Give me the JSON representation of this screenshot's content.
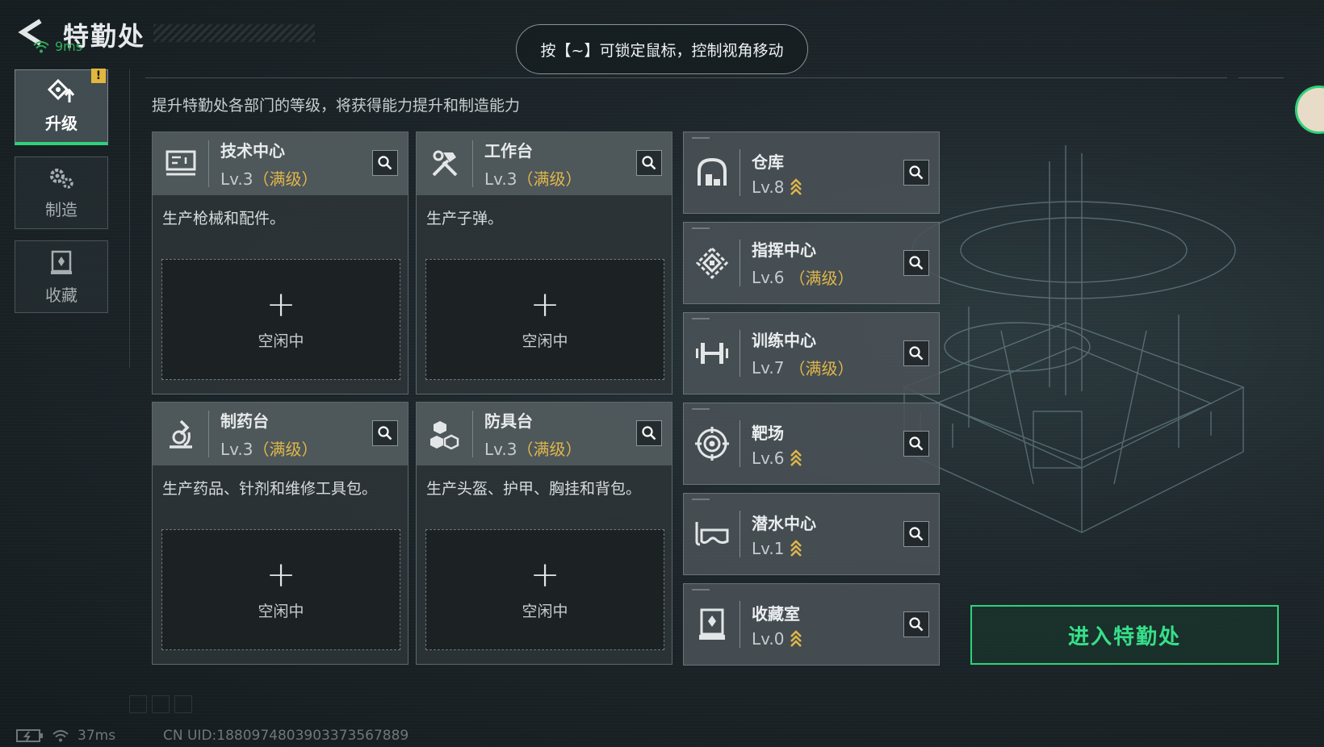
{
  "header": {
    "title": "特勤处",
    "ping_top": "9ms",
    "hint": "按【~】可锁定鼠标，控制视角移动"
  },
  "sidebar": {
    "items": [
      {
        "label": "升级",
        "icon": "upgrade-icon",
        "active": true,
        "alert": "!"
      },
      {
        "label": "制造",
        "icon": "gears-icon",
        "active": false
      },
      {
        "label": "收藏",
        "icon": "collection-icon",
        "active": false
      }
    ]
  },
  "subtitle": "提升特勤处各部门的等级，将获得能力提升和制造能力",
  "workstations": [
    {
      "name": "技术中心",
      "level": "Lv.3",
      "max": "（满级）",
      "desc": "生产枪械和配件。",
      "slot": "空闲中",
      "icon": "tech-center-icon"
    },
    {
      "name": "工作台",
      "level": "Lv.3",
      "max": "（满级）",
      "desc": "生产子弹。",
      "slot": "空闲中",
      "icon": "hammer-wrench-icon"
    },
    {
      "name": "制药台",
      "level": "Lv.3",
      "max": "（满级）",
      "desc": "生产药品、针剂和维修工具包。",
      "slot": "空闲中",
      "icon": "microscope-icon"
    },
    {
      "name": "防具台",
      "level": "Lv.3",
      "max": "（满级）",
      "desc": "生产头盔、护甲、胸挂和背包。",
      "slot": "空闲中",
      "icon": "armor-cubes-icon"
    }
  ],
  "facilities": [
    {
      "name": "仓库",
      "level": "Lv.8",
      "max": "",
      "upgradable": true,
      "icon": "warehouse-icon"
    },
    {
      "name": "指挥中心",
      "level": "Lv.6",
      "max": "（满级）",
      "upgradable": false,
      "icon": "command-center-icon"
    },
    {
      "name": "训练中心",
      "level": "Lv.7",
      "max": "（满级）",
      "upgradable": false,
      "icon": "dumbbell-icon"
    },
    {
      "name": "靶场",
      "level": "Lv.6",
      "max": "",
      "upgradable": true,
      "icon": "target-icon"
    },
    {
      "name": "潜水中心",
      "level": "Lv.1",
      "max": "",
      "upgradable": true,
      "icon": "diving-mask-icon"
    },
    {
      "name": "收藏室",
      "level": "Lv.0",
      "max": "",
      "upgradable": true,
      "icon": "trophy-case-icon"
    }
  ],
  "enter_button": "进入特勤处",
  "status": {
    "ping": "37ms",
    "uid": "CN UID:1880974803903373567889"
  },
  "colors": {
    "accent": "#2fd27a",
    "max_level": "#e0b64a",
    "alert": "#e2b73d"
  }
}
